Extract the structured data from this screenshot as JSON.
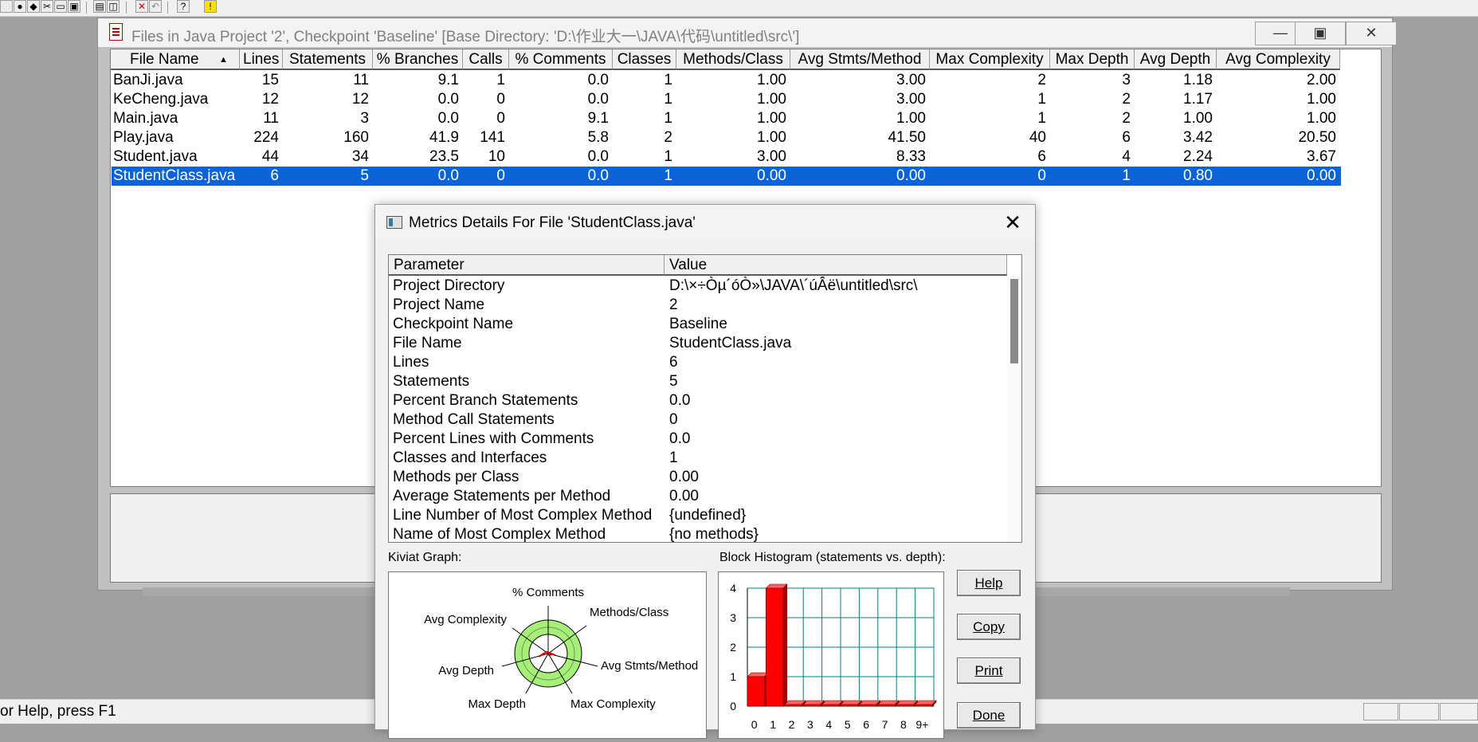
{
  "status_text": "or Help, press F1",
  "files_window": {
    "title": "Files in Java Project '2', Checkpoint 'Baseline'  [Base Directory: 'D:\\作业大一\\JAVA\\代码\\untitled\\src\\']",
    "controls": {
      "minimize": "—",
      "restore": "▣",
      "close": "✕"
    },
    "sort_arrow": "▲",
    "headers": [
      "File Name",
      "Lines",
      "Statements",
      "% Branches",
      "Calls",
      "% Comments",
      "Classes",
      "Methods/Class",
      "Avg Stmts/Method",
      "Max Complexity",
      "Max Depth",
      "Avg Depth",
      "Avg Complexity"
    ],
    "rows": [
      {
        "cells": [
          "BanJi.java",
          "15",
          "11",
          "9.1",
          "1",
          "0.0",
          "1",
          "1.00",
          "3.00",
          "2",
          "3",
          "1.18",
          "2.00"
        ],
        "selected": false
      },
      {
        "cells": [
          "KeCheng.java",
          "12",
          "12",
          "0.0",
          "0",
          "0.0",
          "1",
          "1.00",
          "3.00",
          "1",
          "2",
          "1.17",
          "1.00"
        ],
        "selected": false
      },
      {
        "cells": [
          "Main.java",
          "11",
          "3",
          "0.0",
          "0",
          "9.1",
          "1",
          "1.00",
          "1.00",
          "1",
          "2",
          "1.00",
          "1.00"
        ],
        "selected": false
      },
      {
        "cells": [
          "Play.java",
          "224",
          "160",
          "41.9",
          "141",
          "5.8",
          "2",
          "1.00",
          "41.50",
          "40",
          "6",
          "3.42",
          "20.50"
        ],
        "selected": false
      },
      {
        "cells": [
          "Student.java",
          "44",
          "34",
          "23.5",
          "10",
          "0.0",
          "1",
          "3.00",
          "8.33",
          "6",
          "4",
          "2.24",
          "3.67"
        ],
        "selected": false
      },
      {
        "cells": [
          "StudentClass.java",
          "6",
          "5",
          "0.0",
          "0",
          "0.0",
          "1",
          "0.00",
          "0.00",
          "0",
          "1",
          "0.80",
          "0.00"
        ],
        "selected": true
      }
    ]
  },
  "dialog": {
    "title": "Metrics Details For File 'StudentClass.java'",
    "close": "✕",
    "table_headers": {
      "parameter": "Parameter",
      "value": "Value"
    },
    "params": [
      {
        "name": "Project Directory",
        "value": "D:\\×÷Òµ´óÒ»\\JAVA\\´úÂë\\untitled\\src\\"
      },
      {
        "name": "Project Name",
        "value": "2"
      },
      {
        "name": "Checkpoint Name",
        "value": "Baseline"
      },
      {
        "name": "File Name",
        "value": "StudentClass.java"
      },
      {
        "name": "Lines",
        "value": "6"
      },
      {
        "name": "Statements",
        "value": "5"
      },
      {
        "name": "Percent Branch Statements",
        "value": "0.0"
      },
      {
        "name": "Method Call Statements",
        "value": "0"
      },
      {
        "name": "Percent Lines with Comments",
        "value": "0.0"
      },
      {
        "name": "Classes and Interfaces",
        "value": "1"
      },
      {
        "name": "Methods per Class",
        "value": "0.00"
      },
      {
        "name": "Average Statements per Method",
        "value": "0.00"
      },
      {
        "name": "Line Number of Most Complex Method",
        "value": "{undefined}"
      },
      {
        "name": "Name of Most Complex Method",
        "value": "{no methods}"
      }
    ],
    "kiviat_label": "Kiviat Graph:",
    "kiviat_axes": [
      "% Comments",
      "Methods/Class",
      "Avg Stmts/Method",
      "Max Complexity",
      "Max Depth",
      "Avg Depth",
      "Avg Complexity"
    ],
    "histogram_label": "Block Histogram (statements vs. depth):",
    "buttons": {
      "help": "Help",
      "copy": "Copy",
      "print": "Print",
      "done": "Done"
    },
    "colors": {
      "kiviat_ring": "#a6f07a",
      "histogram_bar": "#ff0000",
      "histogram_grid": "#008080"
    }
  },
  "chart_data": {
    "type": "bar",
    "title": "Block Histogram (statements vs. depth):",
    "categories": [
      "0",
      "1",
      "2",
      "3",
      "4",
      "5",
      "6",
      "7",
      "8",
      "9+"
    ],
    "values": [
      1,
      4,
      0,
      0,
      0,
      0,
      0,
      0,
      0,
      0
    ],
    "y_ticks": [
      "0",
      "1",
      "2",
      "3",
      "4"
    ],
    "ylim": [
      0,
      4
    ],
    "grid": true
  }
}
